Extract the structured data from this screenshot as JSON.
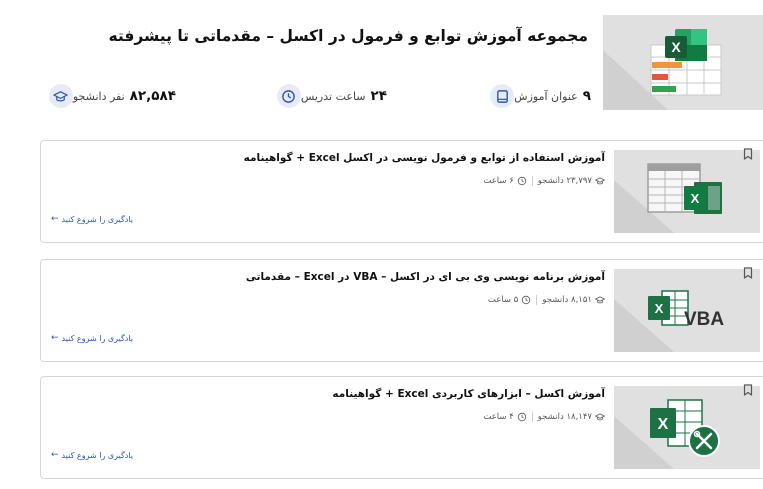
{
  "collection": {
    "title": "مجموعه آموزش توابع و فرمول در اکسل – مقدماتی تا پیشرفته",
    "thumb_icon": "excel-sheet-icon",
    "stats": [
      {
        "value": "۹",
        "label": "عنوان آموزش",
        "icon": "book-icon"
      },
      {
        "value": "۲۴",
        "label": "ساعت تدریس",
        "icon": "clock-icon"
      },
      {
        "value": "۸۲,۵۸۴",
        "label": "نفر دانشجو",
        "icon": "graduation-cap-icon"
      }
    ]
  },
  "courses": [
    {
      "title": "آموزش استفاده از توابع و فرمول نویسی در اکسل Excel + گواهینامه",
      "students": "۲۳,۷۹۷ دانشجو",
      "duration": "۶ ساعت",
      "link": "یادگیری را شروع کنید",
      "thumb_icon": "excel-table-icon"
    },
    {
      "title": "آموزش برنامه نویسی وی بی ای در اکسل – VBA در Excel – مقدماتی",
      "students": "۸,۱۵۱ دانشجو",
      "duration": "۵ ساعت",
      "link": "یادگیری را شروع کنید",
      "thumb_icon": "excel-vba-icon",
      "thumb_text": "VBA"
    },
    {
      "title": "آموزش اکسل – ابزارهای کاربردی Excel + گواهینامه",
      "students": "۱۸,۱۴۷ دانشجو",
      "duration": "۴ ساعت",
      "link": "یادگیری را شروع کنید",
      "thumb_icon": "excel-tools-icon"
    }
  ],
  "colors": {
    "accent": "#2d57b8",
    "excel_green": "#1e7145",
    "icon_bg": "#e8ebf7",
    "thumb_bg": "#e0e0e0"
  }
}
